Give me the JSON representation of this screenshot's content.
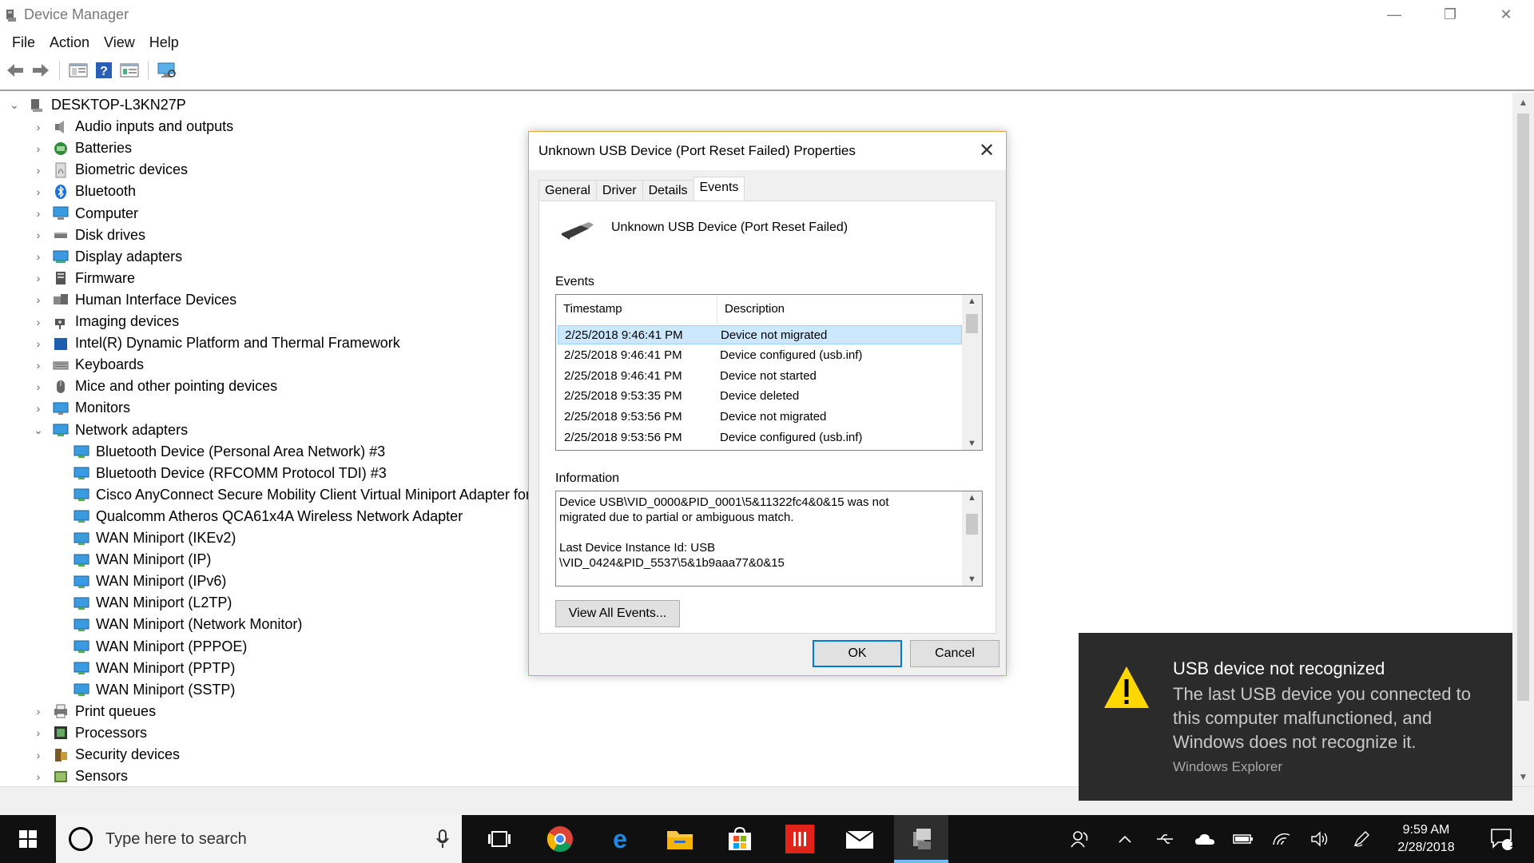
{
  "window": {
    "title": "Device Manager",
    "controls": {
      "minimize": "—",
      "restore": "❐",
      "close": "✕"
    }
  },
  "menu": [
    "File",
    "Action",
    "View",
    "Help"
  ],
  "toolbar": {
    "icons": [
      "back-icon",
      "forward-icon",
      "show-hide-console-tree-icon",
      "help-icon",
      "properties-icon",
      "scan-hardware-icon"
    ]
  },
  "tree": {
    "root": "DESKTOP-L3KN27P",
    "categories": [
      {
        "label": "Audio inputs and outputs",
        "icon": "speaker-icon",
        "expanded": false
      },
      {
        "label": "Batteries",
        "icon": "battery-icon",
        "expanded": false
      },
      {
        "label": "Biometric devices",
        "icon": "fingerprint-icon",
        "expanded": false
      },
      {
        "label": "Bluetooth",
        "icon": "bluetooth-icon",
        "expanded": false
      },
      {
        "label": "Computer",
        "icon": "computer-icon",
        "expanded": false
      },
      {
        "label": "Disk drives",
        "icon": "disk-drive-icon",
        "expanded": false
      },
      {
        "label": "Display adapters",
        "icon": "display-adapter-icon",
        "expanded": false
      },
      {
        "label": "Firmware",
        "icon": "firmware-icon",
        "expanded": false
      },
      {
        "label": "Human Interface Devices",
        "icon": "hid-icon",
        "expanded": false
      },
      {
        "label": "Imaging devices",
        "icon": "camera-icon",
        "expanded": false
      },
      {
        "label": "Intel(R) Dynamic Platform and Thermal Framework",
        "icon": "folder-icon",
        "expanded": false
      },
      {
        "label": "Keyboards",
        "icon": "keyboard-icon",
        "expanded": false
      },
      {
        "label": "Mice and other pointing devices",
        "icon": "mouse-icon",
        "expanded": false
      },
      {
        "label": "Monitors",
        "icon": "monitor-icon",
        "expanded": false
      },
      {
        "label": "Network adapters",
        "icon": "network-adapter-icon",
        "expanded": true
      }
    ],
    "network_children": [
      "Bluetooth Device (Personal Area Network) #3",
      "Bluetooth Device (RFCOMM Protocol TDI) #3",
      "Cisco AnyConnect Secure Mobility Client Virtual Miniport Adapter for",
      "Qualcomm Atheros QCA61x4A Wireless Network Adapter",
      "WAN Miniport (IKEv2)",
      "WAN Miniport (IP)",
      "WAN Miniport (IPv6)",
      "WAN Miniport (L2TP)",
      "WAN Miniport (Network Monitor)",
      "WAN Miniport (PPPOE)",
      "WAN Miniport (PPTP)",
      "WAN Miniport (SSTP)"
    ],
    "after": [
      {
        "label": "Print queues",
        "icon": "printer-icon"
      },
      {
        "label": "Processors",
        "icon": "processor-icon"
      },
      {
        "label": "Security devices",
        "icon": "security-device-icon"
      },
      {
        "label": "Sensors",
        "icon": "sensor-icon"
      }
    ]
  },
  "dialog": {
    "title": "Unknown USB Device (Port Reset Failed) Properties",
    "close": "✕",
    "tabs": [
      "General",
      "Driver",
      "Details",
      "Events"
    ],
    "active_tab": "Events",
    "device_name": "Unknown USB Device (Port Reset Failed)",
    "events_label": "Events",
    "columns": [
      "Timestamp",
      "Description"
    ],
    "events": [
      {
        "ts": "2/25/2018 9:46:41 PM",
        "desc": "Device not migrated",
        "selected": true
      },
      {
        "ts": "2/25/2018 9:46:41 PM",
        "desc": "Device configured (usb.inf)",
        "selected": false
      },
      {
        "ts": "2/25/2018 9:46:41 PM",
        "desc": "Device not started",
        "selected": false
      },
      {
        "ts": "2/25/2018 9:53:35 PM",
        "desc": "Device deleted",
        "selected": false
      },
      {
        "ts": "2/25/2018 9:53:56 PM",
        "desc": "Device not migrated",
        "selected": false
      },
      {
        "ts": "2/25/2018 9:53:56 PM",
        "desc": "Device configured (usb.inf)",
        "selected": false
      }
    ],
    "information_label": "Information",
    "information_lines": [
      "Device USB\\VID_0000&PID_0001\\5&11322fc4&0&15 was not",
      "migrated due to partial or ambiguous match.",
      "",
      "Last Device Instance Id: USB",
      "\\VID_0424&PID_5537\\5&1b9aaa77&0&15"
    ],
    "view_all_button": "View All Events...",
    "ok_button": "OK",
    "cancel_button": "Cancel"
  },
  "toast": {
    "title": "USB device not recognized",
    "body": "The last USB device you connected to this computer malfunctioned, and Windows does not recognize it.",
    "source": "Windows Explorer"
  },
  "taskbar": {
    "search_placeholder": "Type here to search",
    "time": "9:59 AM",
    "date": "2/28/2018",
    "notification_count": "1"
  },
  "colors": {
    "selection": "#cce8ff",
    "dialog_border": "#e8a33a",
    "default_button": "#0078d7",
    "toast_bg": "#2b2b2b",
    "taskbar_bg": "#101010"
  }
}
